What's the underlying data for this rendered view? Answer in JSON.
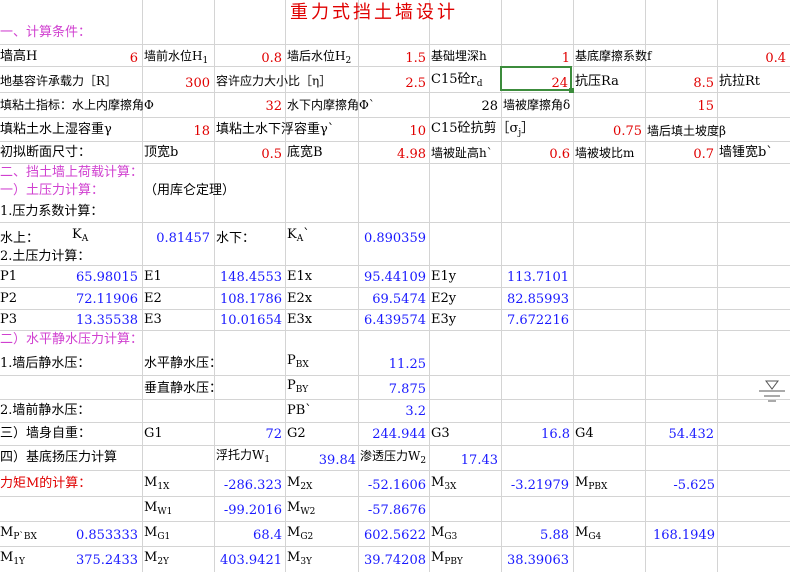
{
  "title": "重力式挡土墙设计",
  "sec1": "一、计算条件：",
  "r1": {
    "h_label": "墙高H",
    "h_val": "6",
    "h1_label": "墙前水位H",
    "h1_sub": "1",
    "h1_val": "0.8",
    "h2_label": "墙后水位H",
    "h2_sub": "2",
    "h2_val": "1.5",
    "base_label": "基础埋深h",
    "base_val": "1",
    "f_label": "基底摩擦系数f",
    "f_val": "0.4"
  },
  "r2": {
    "r_label": "地基容许承载力［R］",
    "r_val": "300",
    "eta_label": "容许应力大小比［η］",
    "eta_val": "2.5",
    "rd_label": "C15砼r",
    "rd_sub": "d",
    "rd_val": "24",
    "ra_label": "抗压Ra",
    "ra_val": "8.5",
    "rt_label": "抗拉Rt"
  },
  "r3": {
    "phi_label": "填粘土指标：水上内摩擦角Φ",
    "phi_val": "32",
    "phi2_label": "水下内摩擦角Φ`",
    "phi2_val": "28",
    "delta_label": "墙被摩擦角δ",
    "delta_val": "15"
  },
  "r4": {
    "gamma_label": "填粘土水上湿容重γ",
    "gamma_val": "18",
    "gamma2_label": "填粘土水下浮容重γ`",
    "gamma2_val": "10",
    "sigma_label": "C15砼抗剪［σ",
    "sigma_sub": "j",
    "sigma_close": "］",
    "sigma_val": "0.75",
    "beta_label": "墙后填土坡度β"
  },
  "r5": {
    "label": "初拟断面尺寸：",
    "b_label": "顶宽b",
    "b_val": "0.5",
    "bb_label": "底宽B",
    "bb_val": "4.98",
    "hh_label": "墙被趾高h`",
    "hh_val": "0.6",
    "m_label": "墙被坡比m",
    "m_val": "0.7",
    "bw_label": "墙锺宽b`"
  },
  "sec2": "二、挡土墙上荷载计算：",
  "sec2a": "一）土压力计算：",
  "sec2a_note": "（用库仑定理）",
  "coef_title": "1.压力系数计算：",
  "coef": {
    "above_label": "水上：",
    "ka_label": "K",
    "ka_sub": "A",
    "ka_val": "0.81457",
    "below_label": "水下：",
    "ka2_label": "K",
    "ka2_sub": "A",
    "ka2_tick": "`",
    "ka2_val": "0.890359"
  },
  "ep_title": "2.土压力计算：",
  "ep_rows": [
    {
      "p": "P1",
      "pv": "65.98015",
      "e": "E1",
      "ev": "148.4553",
      "ex": "E1x",
      "exv": "95.44109",
      "ey": "E1y",
      "eyv": "113.7101"
    },
    {
      "p": "P2",
      "pv": "72.11906",
      "e": "E2",
      "ev": "108.1786",
      "ex": "E2x",
      "exv": "69.5474",
      "ey": "E2y",
      "eyv": "82.85993"
    },
    {
      "p": "P3",
      "pv": "13.35538",
      "e": "E3",
      "ev": "10.01654",
      "ex": "E3x",
      "exv": "6.439574",
      "ey": "E3y",
      "eyv": "7.672216"
    }
  ],
  "sec2b": "二）水平静水压力计算：",
  "hyd": {
    "rear_label": "1.墙后静水压：",
    "h_label": "水平静水压：",
    "pbx": "P",
    "pbx_sub": "BX",
    "pbx_val": "11.25",
    "v_label": "垂直静水压：",
    "pby": "P",
    "pby_sub": "BY",
    "pby_val": "7.875",
    "front_label": "2.墙前静水压：",
    "pb2": "PB`",
    "pb2_val": "3.2"
  },
  "selfw": {
    "label": "三）墙身自重：",
    "g1": "G1",
    "g1v": "72",
    "g2": "G2",
    "g2v": "244.944",
    "g3": "G3",
    "g3v": "16.8",
    "g4": "G4",
    "g4v": "54.432"
  },
  "uplift": {
    "label": "四）基底扬压力计算",
    "w1_label": "浮托力W",
    "w1_sub": "1",
    "w1_val": "39.84",
    "w2_label": "渗透压力W",
    "w2_sub": "2",
    "w2_val": "17.43"
  },
  "moment_title": "力矩M的计算：",
  "m_row1": [
    {
      "l": "M",
      "s": "1X",
      "v": "-286.323"
    },
    {
      "l": "M",
      "s": "2X",
      "v": "-52.1606"
    },
    {
      "l": "M",
      "s": "3X",
      "v": "-3.21979"
    },
    {
      "l": "M",
      "s": "PBX",
      "v": "-5.625"
    }
  ],
  "m_row2": [
    {
      "l": "M",
      "s": "W1",
      "v": "-99.2016"
    },
    {
      "l": "M",
      "s": "W2",
      "v": "-57.8676"
    }
  ],
  "m_row3": [
    {
      "l": "M",
      "s": "P`BX",
      "v": "0.853333"
    },
    {
      "l": "M",
      "s": "G1",
      "v": "68.4"
    },
    {
      "l": "M",
      "s": "G2",
      "v": "602.5622"
    },
    {
      "l": "M",
      "s": "G3",
      "v": "5.88"
    },
    {
      "l": "M",
      "s": "G4",
      "v": "168.1949"
    }
  ],
  "m_row4": [
    {
      "l": "M",
      "s": "1Y",
      "v": "375.2433"
    },
    {
      "l": "M",
      "s": "2Y",
      "v": "403.9421"
    },
    {
      "l": "M",
      "s": "3Y",
      "v": "39.74208"
    },
    {
      "l": "M",
      "s": "PBY",
      "v": "38.39063"
    }
  ],
  "colors": {
    "label_red": "#e00000",
    "value_blue": "#1a1aff",
    "section_pink": "#d040d0",
    "grid": "#d4d4d4",
    "selection": "#3c8c3c"
  },
  "icons": [
    "water-level-icon"
  ]
}
